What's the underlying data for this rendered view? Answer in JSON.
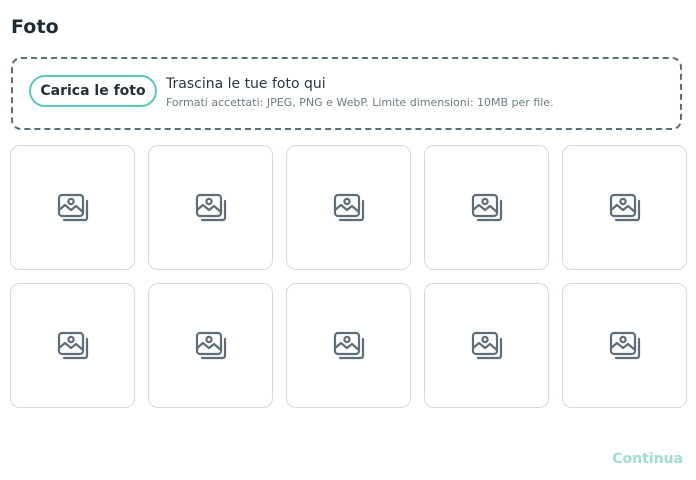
{
  "page": {
    "title": "Foto"
  },
  "dropzone": {
    "button_label": "Carica le foto",
    "title": "Trascina le tue foto qui",
    "hint": "Formati accettati: JPEG, PNG e WebP. Limite dimensioni: 10MB per file."
  },
  "photo_grid": {
    "slot_icon": "image-placeholder-icon",
    "slots": [
      {
        "state": "empty"
      },
      {
        "state": "empty"
      },
      {
        "state": "empty"
      },
      {
        "state": "empty"
      },
      {
        "state": "empty"
      },
      {
        "state": "empty"
      },
      {
        "state": "empty"
      },
      {
        "state": "empty"
      },
      {
        "state": "empty"
      },
      {
        "state": "empty"
      }
    ]
  },
  "footer": {
    "continue_label": "Continua"
  },
  "colors": {
    "accent": "#59c9bf",
    "continue_disabled": "#9fded7",
    "dropzone_border": "#5d6e79",
    "slot_border": "#d3dadf",
    "icon": "#5d6e79"
  }
}
